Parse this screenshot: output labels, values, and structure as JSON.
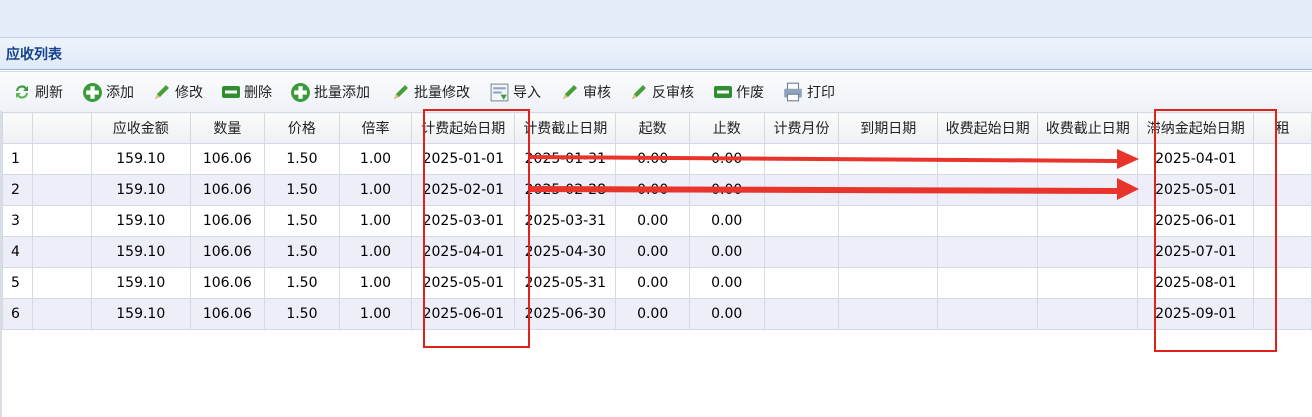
{
  "panel": {
    "title": "应收列表"
  },
  "toolbar": [
    {
      "label": "刷新",
      "icon": "refresh-icon"
    },
    {
      "label": "添加",
      "icon": "add-icon"
    },
    {
      "label": "修改",
      "icon": "edit-icon"
    },
    {
      "label": "删除",
      "icon": "delete-icon"
    },
    {
      "label": "批量添加",
      "icon": "add-icon"
    },
    {
      "label": "批量修改",
      "icon": "edit-icon"
    },
    {
      "label": "导入",
      "icon": "import-icon"
    },
    {
      "label": "审核",
      "icon": "edit-icon"
    },
    {
      "label": "反审核",
      "icon": "edit-icon"
    },
    {
      "label": "作废",
      "icon": "void-icon"
    },
    {
      "label": "打印",
      "icon": "print-icon"
    }
  ],
  "grid": {
    "columns": [
      "",
      "",
      "应收金额",
      "数量",
      "价格",
      "倍率",
      "计费起始日期",
      "计费截止日期",
      "起数",
      "止数",
      "计费月份",
      "到期日期",
      "收费起始日期",
      "收费截止日期",
      "滞纳金起始日期",
      "租"
    ],
    "rows": [
      [
        "1",
        "",
        "159.10",
        "106.06",
        "1.50",
        "1.00",
        "2025-01-01",
        "2025-01-31",
        "0.00",
        "0.00",
        "",
        "",
        "",
        "",
        "2025-04-01",
        ""
      ],
      [
        "2",
        "",
        "159.10",
        "106.06",
        "1.50",
        "1.00",
        "2025-02-01",
        "2025-02-28",
        "0.00",
        "0.00",
        "",
        "",
        "",
        "",
        "2025-05-01",
        ""
      ],
      [
        "3",
        "",
        "159.10",
        "106.06",
        "1.50",
        "1.00",
        "2025-03-01",
        "2025-03-31",
        "0.00",
        "0.00",
        "",
        "",
        "",
        "",
        "2025-06-01",
        ""
      ],
      [
        "4",
        "",
        "159.10",
        "106.06",
        "1.50",
        "1.00",
        "2025-04-01",
        "2025-04-30",
        "0.00",
        "0.00",
        "",
        "",
        "",
        "",
        "2025-07-01",
        ""
      ],
      [
        "5",
        "",
        "159.10",
        "106.06",
        "1.50",
        "1.00",
        "2025-05-01",
        "2025-05-31",
        "0.00",
        "0.00",
        "",
        "",
        "",
        "",
        "2025-08-01",
        ""
      ],
      [
        "6",
        "",
        "159.10",
        "106.06",
        "1.50",
        "1.00",
        "2025-06-01",
        "2025-06-30",
        "0.00",
        "0.00",
        "",
        "",
        "",
        "",
        "2025-09-01",
        ""
      ]
    ]
  },
  "annotation_color": "#e0221b"
}
